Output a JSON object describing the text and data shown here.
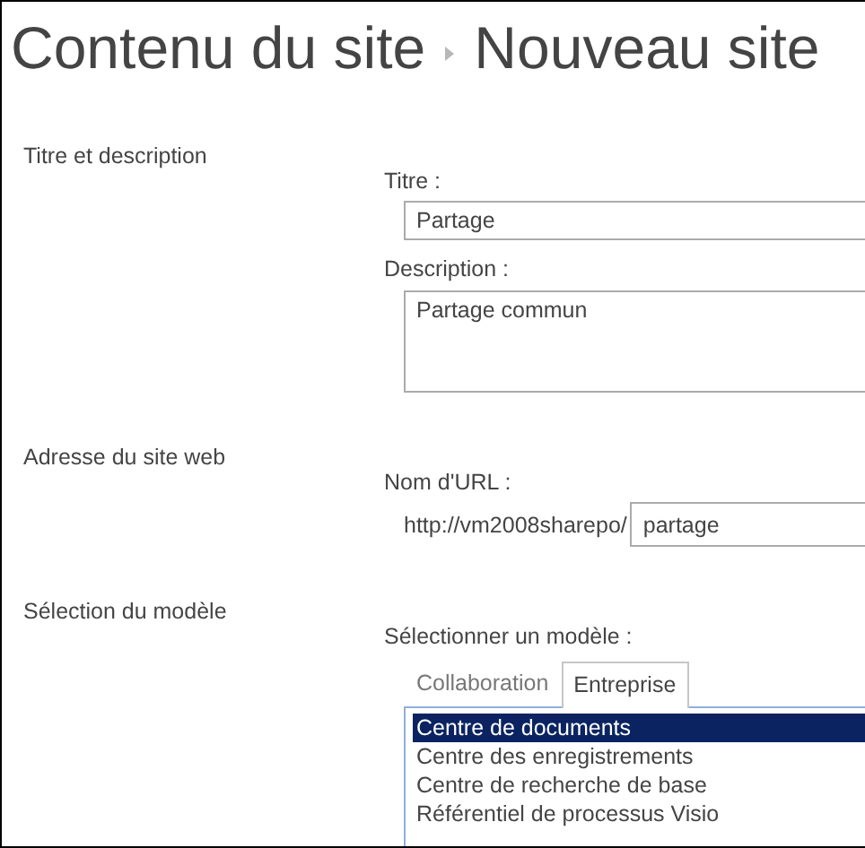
{
  "breadcrumb": [
    {
      "text": "Contenu du site"
    },
    {
      "text": "Nouveau site"
    }
  ],
  "sections": [
    {
      "label": "Titre et description",
      "fields": [
        {
          "kind": "text",
          "label": "Titre :",
          "value": "Partage"
        },
        {
          "kind": "textarea",
          "label": "Description :",
          "value": "Partage commun"
        }
      ]
    },
    {
      "label": "Adresse du site web",
      "fields": [
        {
          "kind": "url",
          "label": "Nom d'URL :",
          "prefix": "http://vm2008sharepo/",
          "value": "partage"
        }
      ]
    },
    {
      "label": "Sélection du modèle",
      "fields": [
        {
          "kind": "template",
          "label": "Sélectionner un modèle :",
          "tabs": [
            {
              "label": "Collaboration",
              "selected": false
            },
            {
              "label": "Entreprise",
              "selected": true
            }
          ],
          "items": [
            {
              "label": "Centre de documents",
              "selected": true
            },
            {
              "label": "Centre des enregistrements",
              "selected": false
            },
            {
              "label": "Centre de recherche de base",
              "selected": false
            },
            {
              "label": "Référentiel de processus Visio",
              "selected": false
            }
          ]
        }
      ]
    }
  ]
}
